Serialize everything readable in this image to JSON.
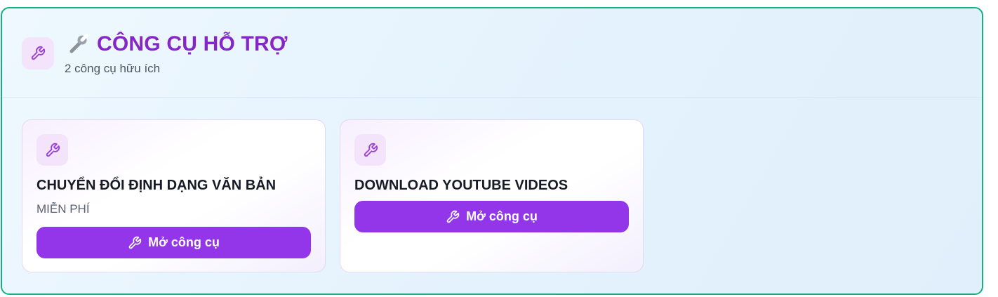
{
  "panel": {
    "icon": "wrench-icon",
    "title_emoji_icon": "wrench-emoji-icon",
    "title": "CÔNG CỤ HỖ TRỢ",
    "subtitle": "2 công cụ hữu ích",
    "border_color": "#16b07e",
    "accent_color": "#8626c8"
  },
  "tools": [
    {
      "icon": "wrench-icon",
      "title": "CHUYỂN ĐỔI ĐỊNH DẠNG VĂN BẢN",
      "subtitle": "MIỄN PHÍ",
      "button_label": "Mở công cụ",
      "button_icon": "wrench-icon"
    },
    {
      "icon": "wrench-icon",
      "title": "DOWNLOAD YOUTUBE VIDEOS",
      "button_label": "Mở công cụ",
      "button_icon": "wrench-icon"
    }
  ],
  "colors": {
    "button": "#9335e8",
    "icon_box": "#f3e4fb"
  }
}
